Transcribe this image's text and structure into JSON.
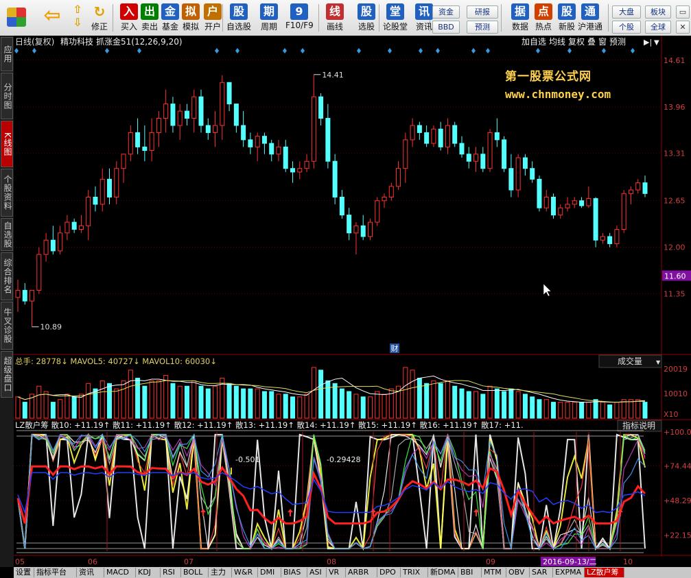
{
  "toolbar": {
    "left_items": [
      {
        "label": "买入",
        "icon": "buy-icon",
        "color": "#d00000"
      },
      {
        "label": "卖出",
        "icon": "sell-icon",
        "color": "#008000"
      },
      {
        "label": "基金",
        "icon": "fund-icon",
        "color": "#2060c0"
      },
      {
        "label": "模拟",
        "icon": "gavel-icon",
        "color": "#c06000"
      },
      {
        "label": "开户",
        "icon": "lock-icon",
        "color": "#c07000"
      },
      {
        "label": "自选股",
        "icon": "star-icon",
        "color": "#2060c0"
      },
      {
        "label": "周期",
        "icon": "clock-icon",
        "color": "#2060c0"
      },
      {
        "label": "F10/F9",
        "icon": "report-icon",
        "color": "#2060c0"
      },
      {
        "label": "画线",
        "icon": "pen-icon",
        "color": "#c03030"
      },
      {
        "label": "选股",
        "icon": "screen-icon",
        "color": "#2060c0"
      },
      {
        "label": "论股堂",
        "icon": "forum-icon",
        "color": "#2060c0"
      },
      {
        "label": "资讯",
        "icon": "news-icon",
        "color": "#2060c0"
      },
      {
        "label": "数据",
        "icon": "pe-icon",
        "color": "#2060c0"
      },
      {
        "label": "热点",
        "icon": "hot-icon",
        "color": "#d04000"
      },
      {
        "label": "新股",
        "icon": "newstock-icon",
        "color": "#2060c0"
      },
      {
        "label": "沪港通",
        "icon": "hk-icon",
        "color": "#2060c0"
      }
    ],
    "small_buttons": {
      "zijin": "资金",
      "bbd": "BBD",
      "yanbao": "研报",
      "yuce": "预测",
      "dapan": "大盘",
      "bankuai": "板块",
      "gegu": "个股",
      "quanqiu": "全球"
    },
    "fold_label": "修正"
  },
  "side_tabs": [
    "应用",
    "分时图",
    "K线图",
    "个股资料",
    "自选股",
    "综合排名",
    "牛叉诊股",
    "超级盘口"
  ],
  "side_active": 2,
  "header": {
    "period": "日线(复权)",
    "stock": "精功科技",
    "indicator": "抓涨金51(12,26,9,20)",
    "right_buttons": [
      "加自选",
      "均线",
      "复权",
      "叠",
      "窗",
      "预测"
    ]
  },
  "logo": {
    "line1": "第一股票公式网",
    "line2": "www.chnmoney.com"
  },
  "price_axis": {
    "ticks": [
      "14.61",
      "13.96",
      "13.31",
      "12.65",
      "12.00",
      "11.35"
    ],
    "current": "11.60"
  },
  "annotations": {
    "high": "14.41",
    "low": "10.89",
    "cai": "财"
  },
  "volume": {
    "label": "总手: 28778↓ MAVOL5: 40727↓ MAVOL10: 60030↓",
    "dropdown": "成交量",
    "axis": [
      "20019",
      "10010",
      "X10"
    ]
  },
  "indicator": {
    "label": "LZ散户筹 散10: +11.19↑ 散11: +11.19↑ 散12: +11.19↑ 散13: +11.19↑ 散14: +11.19↑ 散15: +11.19↑ 散16: +11.19↑ 散17: +11.",
    "help": "指标说明",
    "axis": [
      "+100.0",
      "+74.44",
      "+48.29",
      "+22.15"
    ],
    "values": [
      "-0.501",
      "-0.29428"
    ]
  },
  "x_axis": {
    "labels": [
      "05",
      "06",
      "07",
      "08",
      "09",
      "10"
    ],
    "highlight": "2016-09-13/二"
  },
  "bottom_tabs": [
    "设置",
    "指标平台",
    "资讯",
    "MACD",
    "KDJ",
    "RSI",
    "BOLL",
    "主力",
    "W&R",
    "DMI",
    "BIAS",
    "ASI",
    "VR",
    "ARBR",
    "DPO",
    "TRIX",
    "新DMA",
    "BBI",
    "MTM",
    "OBV",
    "SAR",
    "EXPMA",
    "LZ散户筹"
  ],
  "colors": {
    "up": "#ff3232",
    "down": "#54ffff",
    "bg": "#000000",
    "grid": "#8b0000",
    "text": "#dddddd"
  },
  "chart_data": {
    "type": "candlestick",
    "title": "精功科技 日线(复权)",
    "ylim": [
      10.6,
      14.8
    ],
    "candles": [
      [
        11.3,
        11.55,
        11.1,
        11.4
      ],
      [
        11.4,
        11.5,
        11.2,
        11.25
      ],
      [
        11.25,
        11.4,
        10.89,
        11.4
      ],
      [
        11.4,
        12.0,
        11.35,
        11.9
      ],
      [
        11.9,
        12.2,
        11.8,
        12.1
      ],
      [
        12.1,
        12.3,
        11.9,
        11.95
      ],
      [
        11.95,
        12.3,
        11.9,
        12.2
      ],
      [
        12.2,
        12.45,
        12.1,
        12.35
      ],
      [
        12.35,
        12.4,
        12.2,
        12.25
      ],
      [
        12.25,
        12.45,
        12.2,
        12.3
      ],
      [
        12.3,
        12.8,
        12.1,
        12.7
      ],
      [
        12.7,
        12.85,
        12.5,
        12.6
      ],
      [
        12.6,
        13.1,
        12.5,
        12.95
      ],
      [
        12.95,
        13.1,
        12.6,
        12.7
      ],
      [
        12.7,
        13.2,
        12.6,
        13.1
      ],
      [
        13.1,
        13.3,
        12.9,
        13.3
      ],
      [
        13.3,
        13.7,
        13.2,
        13.6
      ],
      [
        13.6,
        13.8,
        13.3,
        13.4
      ],
      [
        13.4,
        13.7,
        13.2,
        13.35
      ],
      [
        13.35,
        13.8,
        13.2,
        13.6
      ],
      [
        13.6,
        13.9,
        13.4,
        13.8
      ],
      [
        13.8,
        14.2,
        13.6,
        14.0
      ],
      [
        14.0,
        14.1,
        13.6,
        13.7
      ],
      [
        13.7,
        14.0,
        13.5,
        13.9
      ],
      [
        13.9,
        14.0,
        13.7,
        13.8
      ],
      [
        13.8,
        14.2,
        13.6,
        14.1
      ],
      [
        14.1,
        14.2,
        13.6,
        13.7
      ],
      [
        13.7,
        13.8,
        13.5,
        13.6
      ],
      [
        13.6,
        13.9,
        13.4,
        13.7
      ],
      [
        13.7,
        14.4,
        13.5,
        14.3
      ],
      [
        14.3,
        14.3,
        13.9,
        14.0
      ],
      [
        14.0,
        14.0,
        13.6,
        13.7
      ],
      [
        13.7,
        13.9,
        13.4,
        13.5
      ],
      [
        13.5,
        13.6,
        13.3,
        13.4
      ],
      [
        13.4,
        13.6,
        13.2,
        13.55
      ],
      [
        13.55,
        13.6,
        13.3,
        13.45
      ],
      [
        13.45,
        13.5,
        13.2,
        13.3
      ],
      [
        13.3,
        13.5,
        13.2,
        13.4
      ],
      [
        13.4,
        13.5,
        13.05,
        13.1
      ],
      [
        13.1,
        13.2,
        12.9,
        13.05
      ],
      [
        13.05,
        13.2,
        12.95,
        13.1
      ],
      [
        13.1,
        13.3,
        13.05,
        13.2
      ],
      [
        13.2,
        14.41,
        13.1,
        14.1
      ],
      [
        14.1,
        14.15,
        13.7,
        13.8
      ],
      [
        13.8,
        14.0,
        13.1,
        13.2
      ],
      [
        13.2,
        13.3,
        12.6,
        12.7
      ],
      [
        12.7,
        12.8,
        12.4,
        12.45
      ],
      [
        12.45,
        12.55,
        12.1,
        12.2
      ],
      [
        12.2,
        12.35,
        11.9,
        12.3
      ],
      [
        12.3,
        12.45,
        12.1,
        12.15
      ],
      [
        12.15,
        12.4,
        12.1,
        12.35
      ],
      [
        12.35,
        12.7,
        12.3,
        12.65
      ],
      [
        12.65,
        12.75,
        12.55,
        12.7
      ],
      [
        12.7,
        12.9,
        12.65,
        12.85
      ],
      [
        12.85,
        13.2,
        12.8,
        13.1
      ],
      [
        13.1,
        13.6,
        12.9,
        13.5
      ],
      [
        13.5,
        13.8,
        13.4,
        13.7
      ],
      [
        13.7,
        13.75,
        13.5,
        13.6
      ],
      [
        13.6,
        13.7,
        13.4,
        13.45
      ],
      [
        13.45,
        13.7,
        13.4,
        13.65
      ],
      [
        13.65,
        13.75,
        13.35,
        13.4
      ],
      [
        13.4,
        13.8,
        13.3,
        13.7
      ],
      [
        13.7,
        13.75,
        13.4,
        13.45
      ],
      [
        13.45,
        13.55,
        13.25,
        13.3
      ],
      [
        13.3,
        13.4,
        13.1,
        13.2
      ],
      [
        13.2,
        13.4,
        13.05,
        13.3
      ],
      [
        13.3,
        13.4,
        13.05,
        13.1
      ],
      [
        13.1,
        13.65,
        13.05,
        13.6
      ],
      [
        13.6,
        13.8,
        13.4,
        13.5
      ],
      [
        13.5,
        13.55,
        13.05,
        13.1
      ],
      [
        13.1,
        13.3,
        12.7,
        12.8
      ],
      [
        12.8,
        13.3,
        12.7,
        13.25
      ],
      [
        13.25,
        13.3,
        13.0,
        13.1
      ],
      [
        13.1,
        13.2,
        12.9,
        12.95
      ],
      [
        12.95,
        13.0,
        12.5,
        12.55
      ],
      [
        12.55,
        12.8,
        12.5,
        12.7
      ],
      [
        12.7,
        12.75,
        12.4,
        12.45
      ],
      [
        12.45,
        12.6,
        12.4,
        12.55
      ],
      [
        12.55,
        12.7,
        12.5,
        12.6
      ],
      [
        12.6,
        12.7,
        12.55,
        12.65
      ],
      [
        12.65,
        12.7,
        12.55,
        12.58
      ],
      [
        12.58,
        12.85,
        12.55,
        12.68
      ],
      [
        12.68,
        12.7,
        12.0,
        12.1
      ],
      [
        12.1,
        12.2,
        12.05,
        12.15
      ],
      [
        12.15,
        12.2,
        12.0,
        12.05
      ],
      [
        12.05,
        12.3,
        12.0,
        12.25
      ],
      [
        12.25,
        12.8,
        12.2,
        12.75
      ],
      [
        12.75,
        12.85,
        12.6,
        12.8
      ],
      [
        12.8,
        12.95,
        12.75,
        12.9
      ],
      [
        12.9,
        13.0,
        12.7,
        12.75
      ]
    ],
    "volumes": [
      8,
      6,
      9,
      12,
      10,
      6,
      7,
      9,
      8,
      9,
      13,
      11,
      14,
      13,
      11,
      14,
      18,
      15,
      12,
      14,
      14,
      16,
      13,
      12,
      12,
      14,
      12,
      11,
      12,
      15,
      13,
      12,
      11,
      11,
      11,
      10,
      10,
      9,
      9,
      8,
      8,
      9,
      19,
      18,
      14,
      13,
      11,
      10,
      9,
      8,
      8,
      10,
      9,
      11,
      12,
      19,
      18,
      15,
      13,
      14,
      13,
      14,
      12,
      11,
      10,
      10,
      9,
      12,
      11,
      10,
      11,
      10,
      9,
      8,
      7,
      7,
      6,
      6,
      6,
      6,
      6,
      6,
      7,
      6,
      5,
      6,
      7,
      7,
      7,
      6
    ],
    "indicator_series": [
      {
        "name": "散10",
        "color": "#ffffff"
      },
      {
        "name": "散11",
        "color": "#ffff40"
      },
      {
        "name": "散12",
        "color": "#ff4040"
      },
      {
        "name": "散13",
        "color": "#ffffff"
      },
      {
        "name": "散14",
        "color": "#bbbbbb"
      },
      {
        "name": "散15",
        "color": "#40ff40"
      },
      {
        "name": "散16",
        "color": "#cc40cc"
      },
      {
        "name": "散17",
        "color": "#40a0ff"
      }
    ],
    "indicator_ylim": [
      10,
      100
    ]
  }
}
